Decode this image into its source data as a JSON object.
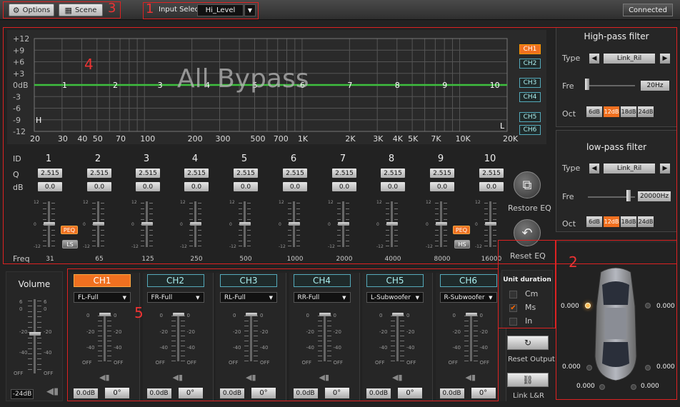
{
  "toolbar": {
    "options_label": "Options",
    "scene_label": "Scene",
    "input_select_label": "Input Select",
    "input_select_value": "Hi_Level",
    "connected_label": "Connected"
  },
  "annotations": [
    "1",
    "2",
    "3",
    "4",
    "5"
  ],
  "graph": {
    "overlay_text": "All Bypass",
    "y_ticks": [
      "+12",
      "+9",
      "+6",
      "+3",
      "0dB",
      "-3",
      "-6",
      "-9",
      "-12"
    ],
    "x_ticks": [
      "20",
      "30",
      "40",
      "50",
      "70",
      "100",
      "200",
      "300",
      "500",
      "700",
      "1K",
      "2K",
      "3K",
      "4K",
      "5K",
      "7K",
      "10K",
      "20K"
    ],
    "band_markers": [
      "1",
      "2",
      "3",
      "4",
      "5",
      "6",
      "7",
      "8",
      "9",
      "10"
    ],
    "low_marker": "H",
    "high_marker": "L",
    "channel_buttons": [
      {
        "label": "CH1",
        "active": true
      },
      {
        "label": "CH2",
        "active": false
      },
      {
        "label": "CH3",
        "active": false
      },
      {
        "label": "CH4",
        "active": false
      },
      {
        "label": "CH5",
        "active": false
      },
      {
        "label": "CH6",
        "active": false
      }
    ],
    "curve_color": "#3ec03e"
  },
  "eq": {
    "id_label": "ID",
    "q_label": "Q",
    "db_label": "dB",
    "freq_label": "Freq",
    "bands": [
      {
        "id": "1",
        "q": "2.515",
        "db": "0.0",
        "freq": "31",
        "filter": "PEQ",
        "type": "LS"
      },
      {
        "id": "2",
        "q": "2.515",
        "db": "0.0",
        "freq": "65"
      },
      {
        "id": "3",
        "q": "2.515",
        "db": "0.0",
        "freq": "125"
      },
      {
        "id": "4",
        "q": "2.515",
        "db": "0.0",
        "freq": "250"
      },
      {
        "id": "5",
        "q": "2.515",
        "db": "0.0",
        "freq": "500"
      },
      {
        "id": "6",
        "q": "2.515",
        "db": "0.0",
        "freq": "1000"
      },
      {
        "id": "7",
        "q": "2.515",
        "db": "0.0",
        "freq": "2000"
      },
      {
        "id": "8",
        "q": "2.515",
        "db": "0.0",
        "freq": "4000"
      },
      {
        "id": "9",
        "q": "2.515",
        "db": "0.0",
        "freq": "8000",
        "filter": "PEQ",
        "type": "HS"
      },
      {
        "id": "10",
        "q": "2.515",
        "db": "0.0",
        "freq": "16000"
      }
    ],
    "slider_ticks": [
      "12",
      "0",
      "-12"
    ],
    "restore_label": "Restore EQ",
    "reset_label": "Reset EQ"
  },
  "highpass": {
    "title": "High-pass filter",
    "type_label": "Type",
    "type_value": "Link_Ril",
    "fre_label": "Fre",
    "fre_value": "20Hz",
    "oct_label": "Oct",
    "oct_options": [
      "6dB",
      "12dB",
      "18dB",
      "24dB"
    ],
    "oct_selected": "12dB"
  },
  "lowpass": {
    "title": "low-pass filter",
    "type_label": "Type",
    "type_value": "Link_Ril",
    "fre_label": "Fre",
    "fre_value": "20000Hz",
    "oct_label": "Oct",
    "oct_options": [
      "6dB",
      "12dB",
      "18dB",
      "24dB"
    ],
    "oct_selected": "12dB"
  },
  "volume": {
    "title": "Volume",
    "ticks": [
      "6",
      "0",
      "-20",
      "-40",
      "OFF"
    ],
    "value": "-24dB",
    "level": 0.55
  },
  "channels": [
    {
      "label": "CH1",
      "active": true,
      "output": "FL-Full",
      "gain": "0.0dB",
      "phase": "0°"
    },
    {
      "label": "CH2",
      "active": false,
      "output": "FR-Full",
      "gain": "0.0dB",
      "phase": "0°"
    },
    {
      "label": "CH3",
      "active": false,
      "output": "RL-Full",
      "gain": "0.0dB",
      "phase": "0°"
    },
    {
      "label": "CH4",
      "active": false,
      "output": "RR-Full",
      "gain": "0.0dB",
      "phase": "0°"
    },
    {
      "label": "CH5",
      "active": false,
      "output": "L-Subwoofer",
      "gain": "0.0dB",
      "phase": "0°"
    },
    {
      "label": "CH6",
      "active": false,
      "output": "R-Subwoofer",
      "gain": "0.0dB",
      "phase": "0°"
    }
  ],
  "channel_ticks": [
    "0",
    "-20",
    "-40",
    "OFF"
  ],
  "unit": {
    "title": "Unit duration",
    "options": [
      {
        "label": "Cm",
        "checked": false
      },
      {
        "label": "Ms",
        "checked": true
      },
      {
        "label": "In",
        "checked": false
      }
    ],
    "reset_output_label": "Reset Output",
    "link_label": "Link  L&R"
  },
  "delays": {
    "front_left": "0.000",
    "front_right": "0.000",
    "rear_left": "0.000",
    "rear_right": "0.000",
    "sub_left": "0.000",
    "sub_right": "0.000"
  }
}
